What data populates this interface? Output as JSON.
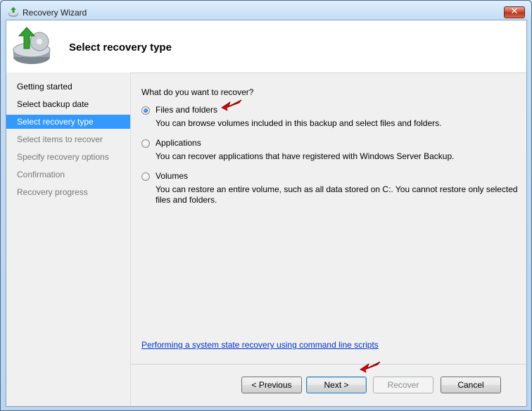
{
  "window": {
    "title": "Recovery Wizard"
  },
  "header": {
    "title": "Select recovery type"
  },
  "steps": [
    {
      "label": "Getting started",
      "state": "done"
    },
    {
      "label": "Select backup date",
      "state": "done"
    },
    {
      "label": "Select recovery type",
      "state": "current"
    },
    {
      "label": "Select items to recover",
      "state": "future"
    },
    {
      "label": "Specify recovery options",
      "state": "future"
    },
    {
      "label": "Confirmation",
      "state": "future"
    },
    {
      "label": "Recovery progress",
      "state": "future"
    }
  ],
  "content": {
    "question": "What do you want to recover?",
    "options": [
      {
        "label": "Files and folders",
        "description": "You can browse volumes included in this backup and select files and folders.",
        "selected": true
      },
      {
        "label": "Applications",
        "description": "You can recover applications that have registered with Windows Server Backup.",
        "selected": false
      },
      {
        "label": "Volumes",
        "description": "You can restore an entire volume, such as all data stored on C:. You cannot restore only selected files and folders.",
        "selected": false
      }
    ],
    "link": "Performing a system state recovery using command line scripts"
  },
  "buttons": {
    "previous": "< Previous",
    "next": "Next >",
    "recover": "Recover",
    "cancel": "Cancel"
  },
  "colors": {
    "selection": "#3399ff",
    "link": "#0033cc",
    "annotation_arrow": "#e00000"
  }
}
